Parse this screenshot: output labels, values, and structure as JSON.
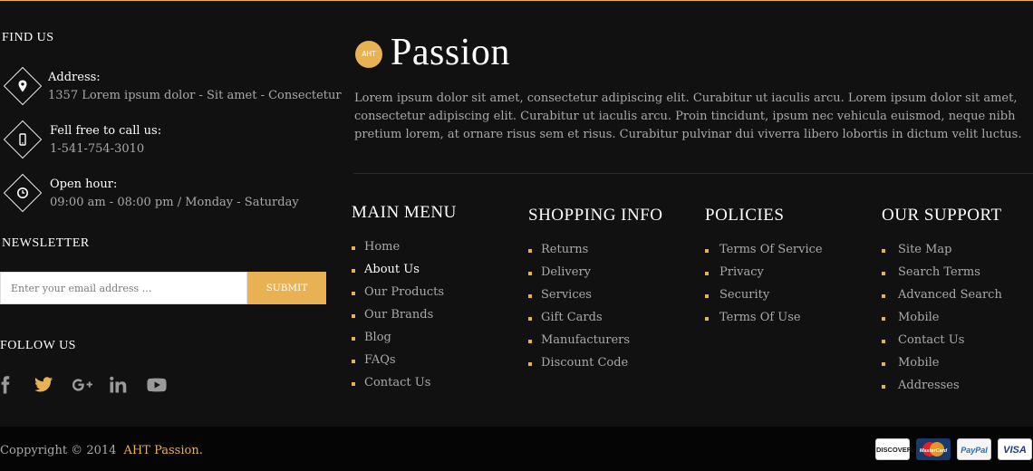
{
  "colors": {
    "accent": "#e8b154",
    "background": "#121112",
    "bottom_bar": "#050505",
    "text": "#a9a9a9",
    "heading": "#ffffff"
  },
  "find_us": {
    "title": "FIND US",
    "address": {
      "icon": "map-pin-icon",
      "label": "Address:",
      "value": "1357 Lorem ipsum dolor - Sit amet - Consectetur"
    },
    "phone": {
      "icon": "mobile-phone-icon",
      "label": "Fell free to call us:",
      "value": "1-541-754-3010"
    },
    "hours": {
      "icon": "clock-icon",
      "label": "Open hour:",
      "value": "09:00 am - 08:00 pm / Monday - Saturday"
    }
  },
  "newsletter": {
    "title": "NEWSLETTER",
    "placeholder": "Enter your email address ...",
    "value": "",
    "button": "SUBMIT"
  },
  "follow": {
    "title": "FOLLOW US",
    "icons": [
      "facebook-icon",
      "twitter-icon",
      "google-plus-icon",
      "linkedin-icon",
      "youtube-icon"
    ]
  },
  "brand": {
    "badge": "AHT",
    "name": "Passion",
    "description": "Lorem ipsum dolor sit amet, consectetur adipiscing elit. Curabitur ut iaculis arcu. Lorem ipsum dolor sit amet, consectetur adipiscing elit. Curabitur ut iaculis arcu. Proin tincidunt, ipsum nec vehicula euismod, neque nibh pretium lorem, at ornare risus sem et risus. Curabitur pulvinar dui viverra libero lobortis in dictum velit luctus."
  },
  "menus": {
    "main": {
      "title": "MAIN MENU",
      "items": [
        "Home",
        "About Us",
        "Our Products",
        "Our Brands",
        "Blog",
        "FAQs",
        "Contact Us"
      ],
      "active": "About Us"
    },
    "shopping": {
      "title": "SHOPPING INFO",
      "items": [
        "Returns",
        "Delivery",
        "Services",
        "Gift Cards",
        "Manufacturers",
        "Discount Code"
      ]
    },
    "policies": {
      "title": "POLICIES",
      "items": [
        "Terms Of Service",
        "Privacy",
        "Security",
        "Terms Of Use"
      ]
    },
    "support": {
      "title": "OUR SUPPORT",
      "items": [
        "Site Map",
        "Search Terms",
        "Advanced Search",
        "Mobile",
        "Contact Us",
        "Mobile",
        "Addresses"
      ]
    }
  },
  "footer": {
    "copyright": "Coppyright © 2014",
    "brand_link": "AHT Passion.",
    "payment_cards": [
      {
        "label": "DISCOVER",
        "icon": "discover-card-icon"
      },
      {
        "label": "MasterCard",
        "icon": "mastercard-icon"
      },
      {
        "label": "PayPal",
        "icon": "paypal-icon"
      },
      {
        "label": "VISA",
        "icon": "visa-icon"
      }
    ]
  }
}
